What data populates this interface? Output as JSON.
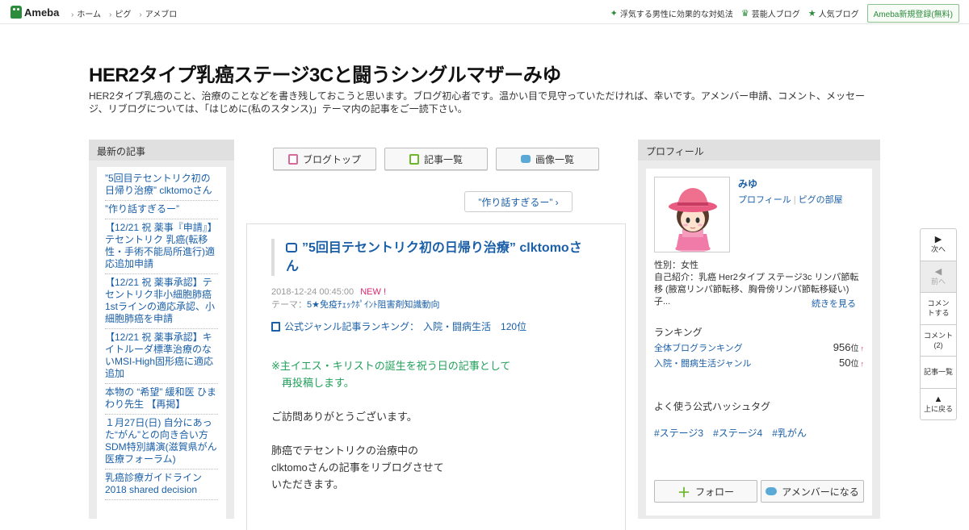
{
  "topbar": {
    "logo": "Ameba",
    "nav": [
      "ホーム",
      "ピグ",
      "アメブロ"
    ],
    "links": [
      {
        "icon": "sparkle-icon",
        "label": "浮気する男性に効果的な対処法"
      },
      {
        "icon": "crown-icon",
        "label": "芸能人ブログ"
      },
      {
        "icon": "star-icon",
        "label": "人気ブログ"
      }
    ],
    "register": "Ameba新規登録(無料)"
  },
  "header": {
    "title": "HER2タイプ乳癌ステージ3Cと闘うシングルマザーみゆ",
    "description": "HER2タイプ乳癌のこと、治療のことなどを書き残しておこうと思います。ブログ初心者です。温かい目で見守っていただければ、幸いです。アメンバー申請、コメント、メッセージ、リブログについては、「はじめに(私のスタンス)」テーマ内の記事をご一読下さい。"
  },
  "left": {
    "heading": "最新の記事",
    "items": [
      "”5回目テセントリク初の日帰り治療” clktomoさん",
      "”作り話すぎるー”",
      "【12/21 祝 薬事『申請』】テセントリク 乳癌(転移性・手術不能局所進行)適応追加申請",
      "【12/21 祝 薬事承認】テセントリク非小細胞肺癌1stラインの適応承認、小細胞肺癌を申請",
      "【12/21 祝 薬事承認】キイトルーダ標準治療のないMSI-High固形癌に適応追加",
      "本物の “希望” 緩和医 ひまわり先生 【再掲】",
      "１月27日(日) 自分にあった“がん”との向き合い方 SDM特別講演(滋賀県がん医療フォーラム)",
      "乳癌診療ガイドライン2018 shared decision"
    ]
  },
  "tabs": {
    "blog_top": "ブログトップ",
    "articles": "記事一覧",
    "images": "画像一覧"
  },
  "next_pill": "”作り話すぎるー” ›",
  "article": {
    "title": "”5回目テセントリク初の日帰り治療” clktomoさん",
    "datetime": "2018-12-24 00:45:00",
    "new_badge": "NEW !",
    "theme_label": "テーマ：",
    "theme": "5★免疫ﾁｪｯｸﾎﾟｲﾝﾄ阻害剤知識動向",
    "ranking_label": "公式ジャンル記事ランキング：",
    "ranking_value": "入院・闘病生活　120位",
    "body_green_1": "※主イエス・キリストの誕生を祝う日の記事として",
    "body_green_2": "　再投稿します。",
    "body_p1": "ご訪問ありがとうございます。",
    "body_p2_l1": "肺癌でテセントリクの治療中の",
    "body_p2_l2": "clktomoさんの記事をリブログさせて",
    "body_p2_l3": "いただきます。"
  },
  "profile": {
    "heading": "プロフィール",
    "name": "みゆ",
    "link_profile": "プロフィール",
    "link_room": "ピグの部屋",
    "gender": "性別：女性",
    "intro": "自己紹介：乳癌 Her2タイプ ステージ3c リンパ節転移 (腋窩リンパ節転移、胸骨傍リンパ節転移疑い) 子...",
    "more": "続きを見る",
    "ranking_title": "ランキング",
    "rankings": [
      {
        "label": "全体ブログランキング",
        "value": "956",
        "unit": "位",
        "trend": "↑"
      },
      {
        "label": "入院・闘病生活ジャンル",
        "value": "50",
        "unit": "位",
        "trend": "↑"
      }
    ],
    "hashtag_title": "よく使う公式ハッシュタグ",
    "hashtags": [
      "#ステージ3",
      "#ステージ4",
      "#乳がん"
    ],
    "follow": "フォロー",
    "amember": "アメンバーになる"
  },
  "floatnav": {
    "next": "次へ",
    "prev": "前へ",
    "comment": "コメントする",
    "comments_label": "コメント",
    "comments_count": "(2)",
    "article_list": "記事一覧",
    "top": "上に戻る"
  },
  "colors": {
    "link": "#1a5fa8",
    "brand_green": "#2d8c3c",
    "new_pink": "#e0246b",
    "body_green": "#20a05a"
  }
}
